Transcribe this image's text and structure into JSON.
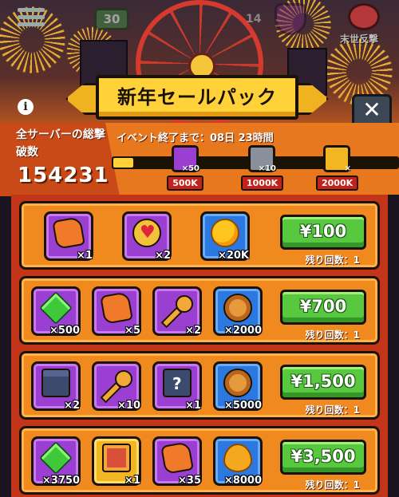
{
  "hud": {
    "level": "30",
    "stage": "14",
    "boss_label": "末世反撃"
  },
  "banner": {
    "title": "新年セールパック"
  },
  "close_label": "✕",
  "info_label": "i",
  "server": {
    "label": "全サーバーの総撃破数",
    "count": "154231"
  },
  "event": {
    "time_text": "イベント終了まで：08日 23時間",
    "progress": 0.07
  },
  "milestones": [
    {
      "icon": "gem-icon",
      "count": "×50",
      "label": "500K",
      "color": "#9b3fd2"
    },
    {
      "icon": "mystery-box-icon",
      "count": "×10",
      "label": "1000K",
      "color": "#8a8f9c"
    },
    {
      "icon": "key-icon",
      "count": "×",
      "label": "2000K",
      "color": "#f2b622"
    }
  ],
  "packs": [
    {
      "price": "¥100",
      "remaining": "残り回数：1",
      "items": [
        {
          "icon": "puzzle-piece-icon",
          "qty": "×1",
          "frame": "purple"
        },
        {
          "icon": "heart-token-icon",
          "qty": "×2",
          "frame": "purple"
        },
        {
          "icon": "gold-coin-icon",
          "qty": "×20K",
          "frame": "blue"
        }
      ]
    },
    {
      "price": "¥700",
      "remaining": "残り回数：1",
      "items": [
        {
          "icon": "green-gem-icon",
          "qty": "×500",
          "frame": "purple"
        },
        {
          "icon": "puzzle-piece-icon",
          "qty": "×5",
          "frame": "purple"
        },
        {
          "icon": "gold-key-icon",
          "qty": "×2",
          "frame": "purple"
        },
        {
          "icon": "lion-medal-icon",
          "qty": "×2000",
          "frame": "blue"
        }
      ]
    },
    {
      "price": "¥1,500",
      "remaining": "残り回数：1",
      "items": [
        {
          "icon": "chest-icon",
          "qty": "×2",
          "frame": "purple"
        },
        {
          "icon": "gold-key-icon",
          "qty": "×10",
          "frame": "purple"
        },
        {
          "icon": "mystery-chest-icon",
          "qty": "×1",
          "frame": "purple"
        },
        {
          "icon": "lion-medal-icon",
          "qty": "×5000",
          "frame": "blue"
        }
      ]
    },
    {
      "price": "¥3,500",
      "remaining": "残り回数：1",
      "items": [
        {
          "icon": "green-gem-icon",
          "qty": "×3750",
          "frame": "purple"
        },
        {
          "icon": "supply-crate-icon",
          "qty": "×1",
          "frame": "gold"
        },
        {
          "icon": "puzzle-piece-icon",
          "qty": "×35",
          "frame": "purple"
        },
        {
          "icon": "oil-drop-icon",
          "qty": "×8000",
          "frame": "blue"
        }
      ]
    }
  ]
}
